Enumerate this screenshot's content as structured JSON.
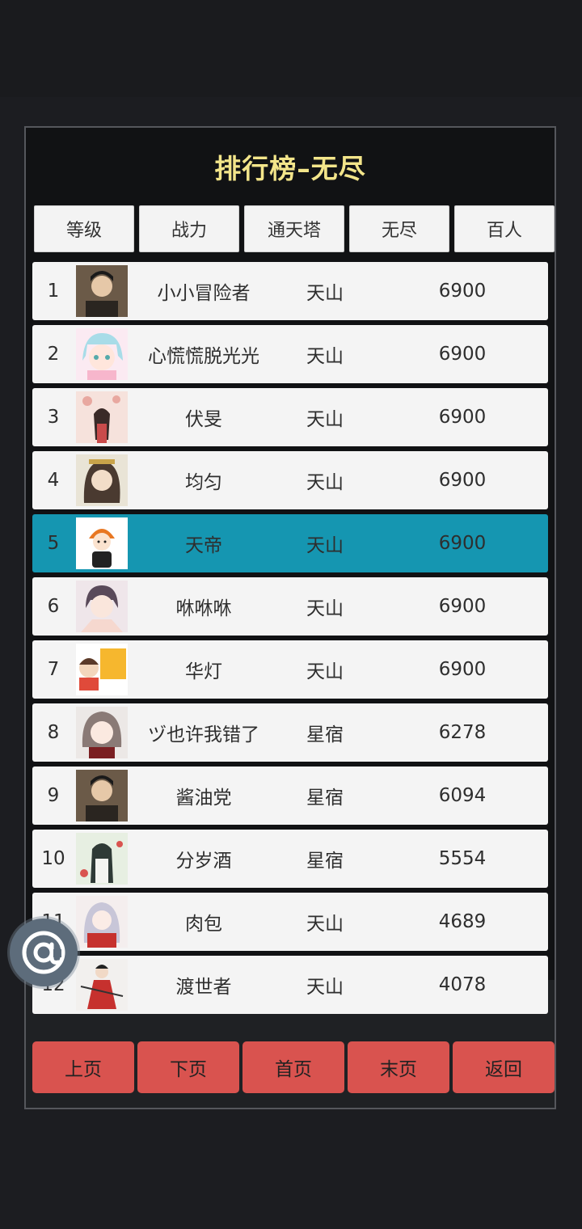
{
  "title": "排行榜–无尽",
  "tabs": [
    {
      "label": "等级"
    },
    {
      "label": "战力"
    },
    {
      "label": "通天塔"
    },
    {
      "label": "无尽"
    },
    {
      "label": "百人"
    }
  ],
  "rows": [
    {
      "rank": "1",
      "name": "小小冒险者",
      "realm": "天山",
      "score": "6900"
    },
    {
      "rank": "2",
      "name": "心慌慌脱光光",
      "realm": "天山",
      "score": "6900"
    },
    {
      "rank": "3",
      "name": "伏旻",
      "realm": "天山",
      "score": "6900"
    },
    {
      "rank": "4",
      "name": "均匀",
      "realm": "天山",
      "score": "6900"
    },
    {
      "rank": "5",
      "name": "天帝",
      "realm": "天山",
      "score": "6900"
    },
    {
      "rank": "6",
      "name": "咻咻咻",
      "realm": "天山",
      "score": "6900"
    },
    {
      "rank": "7",
      "name": "华灯",
      "realm": "天山",
      "score": "6900"
    },
    {
      "rank": "8",
      "name": "ヅ也许我错了",
      "realm": "星宿",
      "score": "6278"
    },
    {
      "rank": "9",
      "name": "酱油党",
      "realm": "星宿",
      "score": "6094"
    },
    {
      "rank": "10",
      "name": "分岁酒",
      "realm": "星宿",
      "score": "5554"
    },
    {
      "rank": "11",
      "name": "肉包",
      "realm": "天山",
      "score": "4689"
    },
    {
      "rank": "12",
      "name": "渡世者",
      "realm": "天山",
      "score": "4078"
    }
  ],
  "highlight_rank": "5",
  "buttons": [
    {
      "label": "上页"
    },
    {
      "label": "下页"
    },
    {
      "label": "首页"
    },
    {
      "label": "末页"
    },
    {
      "label": "返回"
    }
  ],
  "floating_button": {
    "icon": "at-icon"
  },
  "colors": {
    "title": "#f3e58a",
    "highlight_row": "#1596b1",
    "page_button": "#d9534f"
  }
}
